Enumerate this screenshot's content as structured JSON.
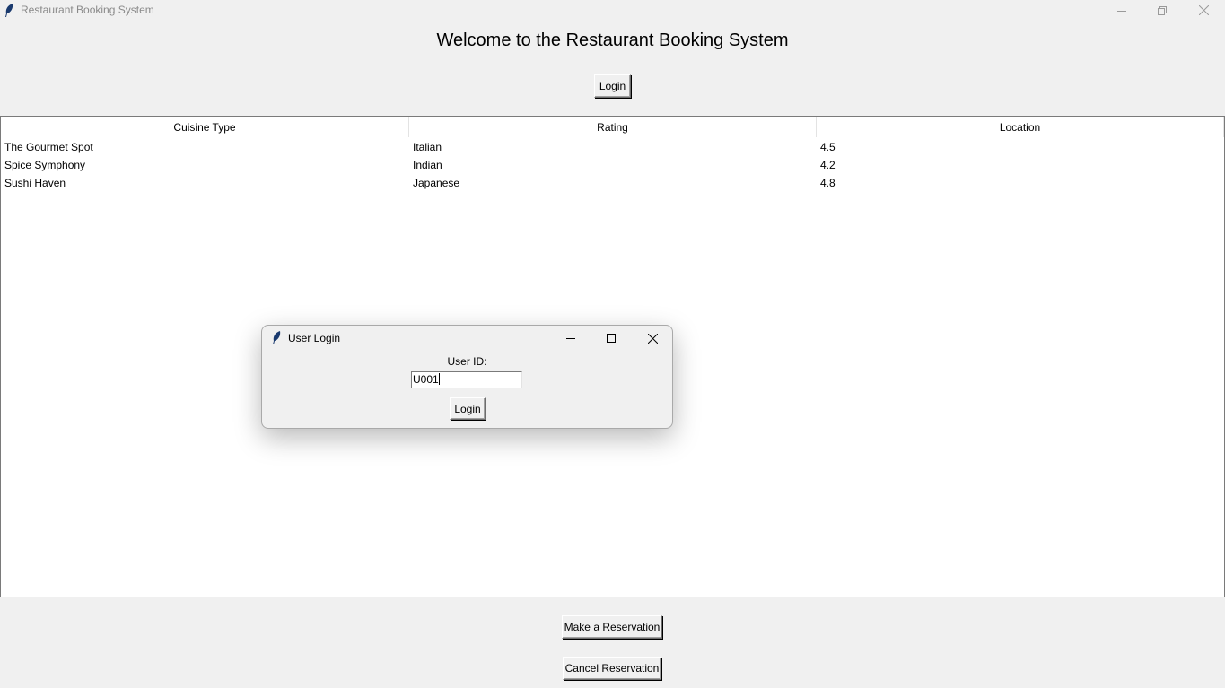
{
  "window": {
    "title": "Restaurant Booking System"
  },
  "heading": "Welcome to the Restaurant Booking System",
  "login_button": "Login",
  "table": {
    "columns": [
      "Cuisine Type",
      "Rating",
      "Location"
    ],
    "rows": [
      [
        "The Gourmet Spot",
        "Italian",
        "4.5"
      ],
      [
        "Spice Symphony",
        "Indian",
        "4.2"
      ],
      [
        "Sushi Haven",
        "Japanese",
        "4.8"
      ]
    ]
  },
  "actions": {
    "make": "Make a Reservation",
    "cancel": "Cancel Reservation"
  },
  "dialog": {
    "title": "User Login",
    "label": "User ID:",
    "value": "U001",
    "button": "Login"
  }
}
